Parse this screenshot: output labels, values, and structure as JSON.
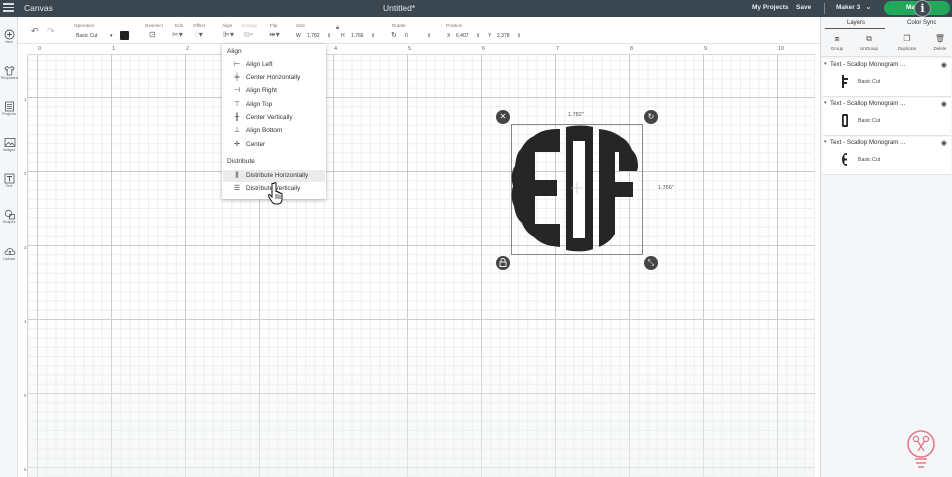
{
  "app": {
    "title": "Canvas",
    "document_title": "Untitled*",
    "my_projects": "My Projects",
    "save": "Save",
    "machine": "Maker 3",
    "make_it": "Make It",
    "accent_color": "#22a85a",
    "header_color": "#3a4750"
  },
  "sidebar": {
    "items": [
      {
        "label": "New",
        "icon": "plus-circle-icon"
      },
      {
        "label": "Templates",
        "icon": "shirt-icon"
      },
      {
        "label": "Projects",
        "icon": "grid-icon"
      },
      {
        "label": "Images",
        "icon": "image-icon"
      },
      {
        "label": "Text",
        "icon": "text-icon"
      },
      {
        "label": "Shapes",
        "icon": "shapes-icon"
      },
      {
        "label": "Upload",
        "icon": "cloud-upload-icon"
      }
    ]
  },
  "toolbar": {
    "operation_label": "Operation",
    "operation_value": "Basic Cut",
    "deselect_label": "Deselect",
    "edit_label": "Edit",
    "offset_label": "Offset",
    "align_label": "Align",
    "arrange_label": "Arrange",
    "flip_label": "Flip",
    "size_label": "Size",
    "size_w_label": "W",
    "size_w": "1.782",
    "size_h_label": "H",
    "size_h": "1.766",
    "rotate_label": "Rotate",
    "rotate_value": "0",
    "position_label": "Position",
    "pos_x_label": "X",
    "pos_x": "6.407",
    "pos_y_label": "Y",
    "pos_y": "2.378"
  },
  "ruler": {
    "top": [
      "0",
      "1",
      "2",
      "3",
      "4",
      "5",
      "6",
      "7",
      "8",
      "9",
      "10"
    ],
    "left": [
      "1",
      "2",
      "3",
      "4",
      "5",
      "6"
    ]
  },
  "align_menu": {
    "align_heading": "Align",
    "align_items": [
      "Align Left",
      "Center Horizontally",
      "Align Right",
      "Align Top",
      "Center Vertically",
      "Align Bottom",
      "Center"
    ],
    "distribute_heading": "Distribute",
    "distribute_items": [
      "Distribute Horizontally",
      "Distribute Vertically"
    ]
  },
  "selection": {
    "width_label": "1.782\"",
    "height_label": "1.766\""
  },
  "right_panel": {
    "tabs": [
      "Layers",
      "Color Sync"
    ],
    "actions": [
      "Group",
      "UnGroup",
      "Duplicate",
      "Delete"
    ],
    "layers": [
      {
        "name": "Text - Scallop Monogram ...",
        "operation": "Basic Cut",
        "thumb": "F"
      },
      {
        "name": "Text - Scallop Monogram ...",
        "operation": "Basic Cut",
        "thumb": "D"
      },
      {
        "name": "Text - Scallop Monogram ...",
        "operation": "Basic Cut",
        "thumb": "E"
      }
    ]
  }
}
